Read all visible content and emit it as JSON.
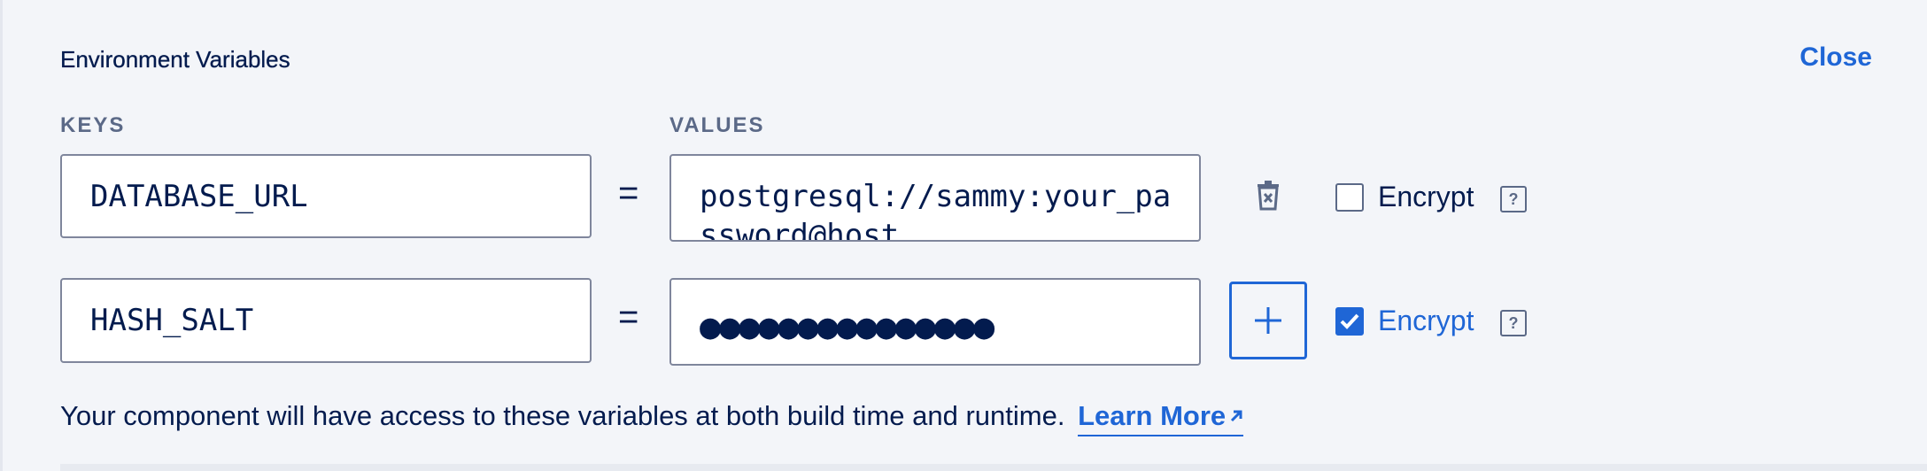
{
  "header": {
    "title": "Environment Variables",
    "close_label": "Close"
  },
  "columns": {
    "keys_label": "KEYS",
    "values_label": "VALUES"
  },
  "rows": [
    {
      "key": "DATABASE_URL",
      "separator": "=",
      "value": "postgresql://sammy:your_password@host",
      "encrypt_checked": false,
      "encrypt_label": "Encrypt",
      "help": "?",
      "action_icon": "trash-icon"
    },
    {
      "key": "HASH_SALT",
      "separator": "=",
      "value": "●●●●●●●●●●●●●●●",
      "encrypt_checked": true,
      "encrypt_label": "Encrypt",
      "help": "?",
      "action_icon": "plus-icon"
    }
  ],
  "footer": {
    "text": "Your component will have access to these variables at both build time and runtime.",
    "link_label": "Learn More"
  },
  "colors": {
    "accent": "#1f66d6",
    "text": "#031b4e",
    "muted": "#5b6987",
    "background": "#f3f5f9"
  }
}
